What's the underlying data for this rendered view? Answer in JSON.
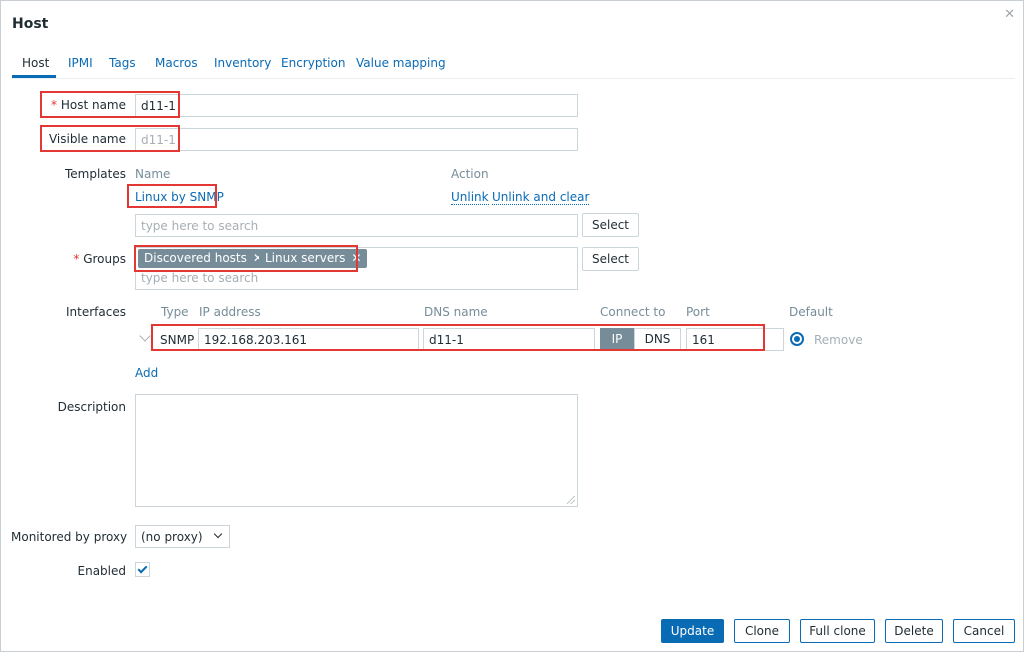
{
  "dialog": {
    "title": "Host",
    "close_icon": "close-icon"
  },
  "tabs": [
    {
      "label": "Host",
      "active": true
    },
    {
      "label": "IPMI"
    },
    {
      "label": "Tags"
    },
    {
      "label": "Macros"
    },
    {
      "label": "Inventory"
    },
    {
      "label": "Encryption"
    },
    {
      "label": "Value mapping"
    }
  ],
  "form": {
    "host_name": {
      "required_mark": "*",
      "label": "Host name",
      "value": "d11-1"
    },
    "visible_name": {
      "label": "Visible name",
      "placeholder": "d11-1"
    },
    "templates": {
      "label": "Templates",
      "col_name": "Name",
      "col_action": "Action",
      "linked": "Linux by SNMP",
      "unlink": "Unlink",
      "unlink_clear": "Unlink and clear",
      "search_placeholder": "type here to search",
      "select_label": "Select"
    },
    "groups": {
      "required_mark": "*",
      "label": "Groups",
      "chips": [
        "Discovered hosts",
        "Linux servers"
      ],
      "chip_remove_icon": "close-icon",
      "search_placeholder": "type here to search",
      "select_label": "Select"
    },
    "interfaces": {
      "label": "Interfaces",
      "headers": {
        "type": "Type",
        "ip": "IP address",
        "dns": "DNS name",
        "connect": "Connect to",
        "port": "Port",
        "default": "Default"
      },
      "row": {
        "type": "SNMP",
        "ip": "192.168.203.161",
        "dns": "d11-1",
        "connect_ip": "IP",
        "connect_dns": "DNS",
        "connect_selected": "IP",
        "port": "161",
        "remove": "Remove"
      },
      "add": "Add"
    },
    "description": {
      "label": "Description",
      "value": ""
    },
    "proxy": {
      "label": "Monitored by proxy",
      "value": "(no proxy)"
    },
    "enabled": {
      "label": "Enabled",
      "checked": true
    }
  },
  "footer": {
    "update": "Update",
    "clone": "Clone",
    "full_clone": "Full clone",
    "delete": "Delete",
    "cancel": "Cancel"
  },
  "colors": {
    "accent": "#0a6bb5",
    "highlight": "#e33734",
    "chip": "#768d99"
  }
}
